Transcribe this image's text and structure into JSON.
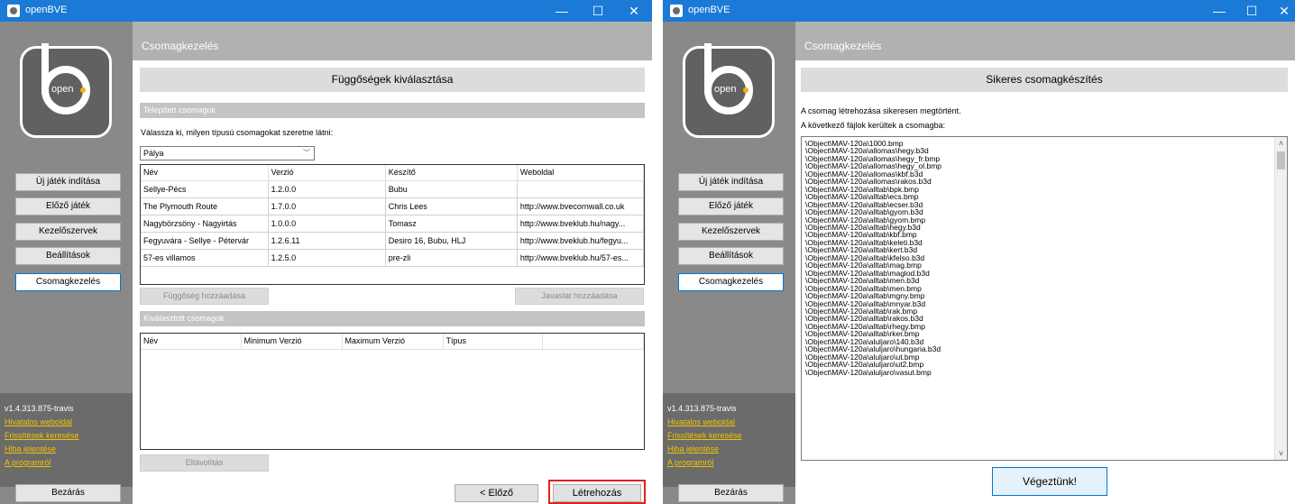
{
  "left_window": {
    "title": "openBVE",
    "controls": {
      "minimize": "—",
      "maximize": "☐",
      "close": "✕"
    },
    "logo_text": "open",
    "sidebar": {
      "buttons": [
        "Új játék indítása",
        "Előző játék",
        "Kezelőszervek",
        "Beállítások",
        "Csomagkezelés"
      ],
      "version": "v1.4.313.875-travis",
      "links": [
        "Hivatalos weboldal",
        "Frissítések keresése",
        "Hiba jelentése",
        "A programról"
      ],
      "close_button": "Bezárás"
    },
    "header": "Csomagkezelés",
    "section_title": "Függőségek kiválasztása",
    "installed_group": "Telepített csomagok",
    "type_prompt": "Válassza ki, milyen típusú csomagokat szeretne látni:",
    "type_value": "Pálya",
    "installed_columns": [
      "Név",
      "Verzió",
      "Készítő",
      "Weboldal"
    ],
    "installed_rows": [
      [
        "Sellye-Pécs",
        "1.2.0.0",
        "Bubu",
        ""
      ],
      [
        "The Plymouth Route",
        "1.7.0.0",
        "Chris Lees",
        "http://www.bvecornwall.co.uk"
      ],
      [
        "Nagybörzsöny - Nagyirtás",
        "1.0.0.0",
        "Tomasz",
        "http://www.bveklub.hu/nagy..."
      ],
      [
        "Fegyuvára - Sellye - Pétervár",
        "1.2.6.11",
        "Desiro 16, Bubu, HLJ",
        "http://www.bveklub.hu/fegyu..."
      ],
      [
        "57-es villamos",
        "1.2.5.0",
        "pre-zli",
        "http://www.bveklub.hu/57-es..."
      ]
    ],
    "add_dependency": "Függőség hozzáadása",
    "add_recommendation": "Javaslat hozzáadása",
    "selected_group": "Kiválasztott csomagok",
    "selected_columns": [
      "Név",
      "Minimum Verzió",
      "Maximum Verzió",
      "Típus"
    ],
    "remove": "Eltávolítás",
    "prev": "< Előző",
    "create": "Létrehozás"
  },
  "right_window": {
    "title": "openBVE",
    "controls": {
      "minimize": "—",
      "maximize": "☐",
      "close": "✕"
    },
    "logo_text": "open",
    "sidebar": {
      "buttons": [
        "Új játék indítása",
        "Előző játék",
        "Kezelőszervek",
        "Beállítások",
        "Csomagkezelés"
      ],
      "version": "v1.4.313.875-travis",
      "links": [
        "Hivatalos weboldal",
        "Frissítések keresése",
        "Hiba jelentése",
        "A programról"
      ],
      "close_button": "Bezárás"
    },
    "header": "Csomagkezelés",
    "section_title": "Sikeres csomagkészítés",
    "msg1": "A csomag létrehozása sikeresen megtörtént.",
    "msg2": "A következő fájlok kerültek a csomagba:",
    "files": [
      "\\Object\\MAV-120a\\1000.bmp",
      "\\Object\\MAV-120a\\allomas\\hegy.b3d",
      "\\Object\\MAV-120a\\allomas\\hegy_fr.bmp",
      "\\Object\\MAV-120a\\allomas\\hegy_ol.bmp",
      "\\Object\\MAV-120a\\allomas\\kbf.b3d",
      "\\Object\\MAV-120a\\allomas\\rakos.b3d",
      "\\Object\\MAV-120a\\alltab\\bpk.bmp",
      "\\Object\\MAV-120a\\alltab\\ecs.bmp",
      "\\Object\\MAV-120a\\alltab\\ecser.b3d",
      "\\Object\\MAV-120a\\alltab\\gyom.b3d",
      "\\Object\\MAV-120a\\alltab\\gyom.bmp",
      "\\Object\\MAV-120a\\alltab\\hegy.b3d",
      "\\Object\\MAV-120a\\alltab\\kbf.bmp",
      "\\Object\\MAV-120a\\alltab\\keleti.b3d",
      "\\Object\\MAV-120a\\alltab\\kert.b3d",
      "\\Object\\MAV-120a\\alltab\\kfelso.b3d",
      "\\Object\\MAV-120a\\alltab\\mag.bmp",
      "\\Object\\MAV-120a\\alltab\\maglod.b3d",
      "\\Object\\MAV-120a\\alltab\\men.b3d",
      "\\Object\\MAV-120a\\alltab\\men.bmp",
      "\\Object\\MAV-120a\\alltab\\mgny.bmp",
      "\\Object\\MAV-120a\\alltab\\mnyar.b3d",
      "\\Object\\MAV-120a\\alltab\\rak.bmp",
      "\\Object\\MAV-120a\\alltab\\rakos.b3d",
      "\\Object\\MAV-120a\\alltab\\rhegy.bmp",
      "\\Object\\MAV-120a\\alltab\\rker.bmp",
      "\\Object\\MAV-120a\\aluljaro\\140.b3d",
      "\\Object\\MAV-120a\\aluljaro\\hungaria.b3d",
      "\\Object\\MAV-120a\\aluljaro\\ut.bmp",
      "\\Object\\MAV-120a\\aluljaro\\ut2.bmp",
      "\\Object\\MAV-120a\\aluljaro\\vasut.bmp"
    ],
    "done": "Végeztünk!"
  },
  "colors": {
    "titlebar": "#1a7ad6",
    "link": "#f0c400",
    "highlight": "#e02020"
  }
}
